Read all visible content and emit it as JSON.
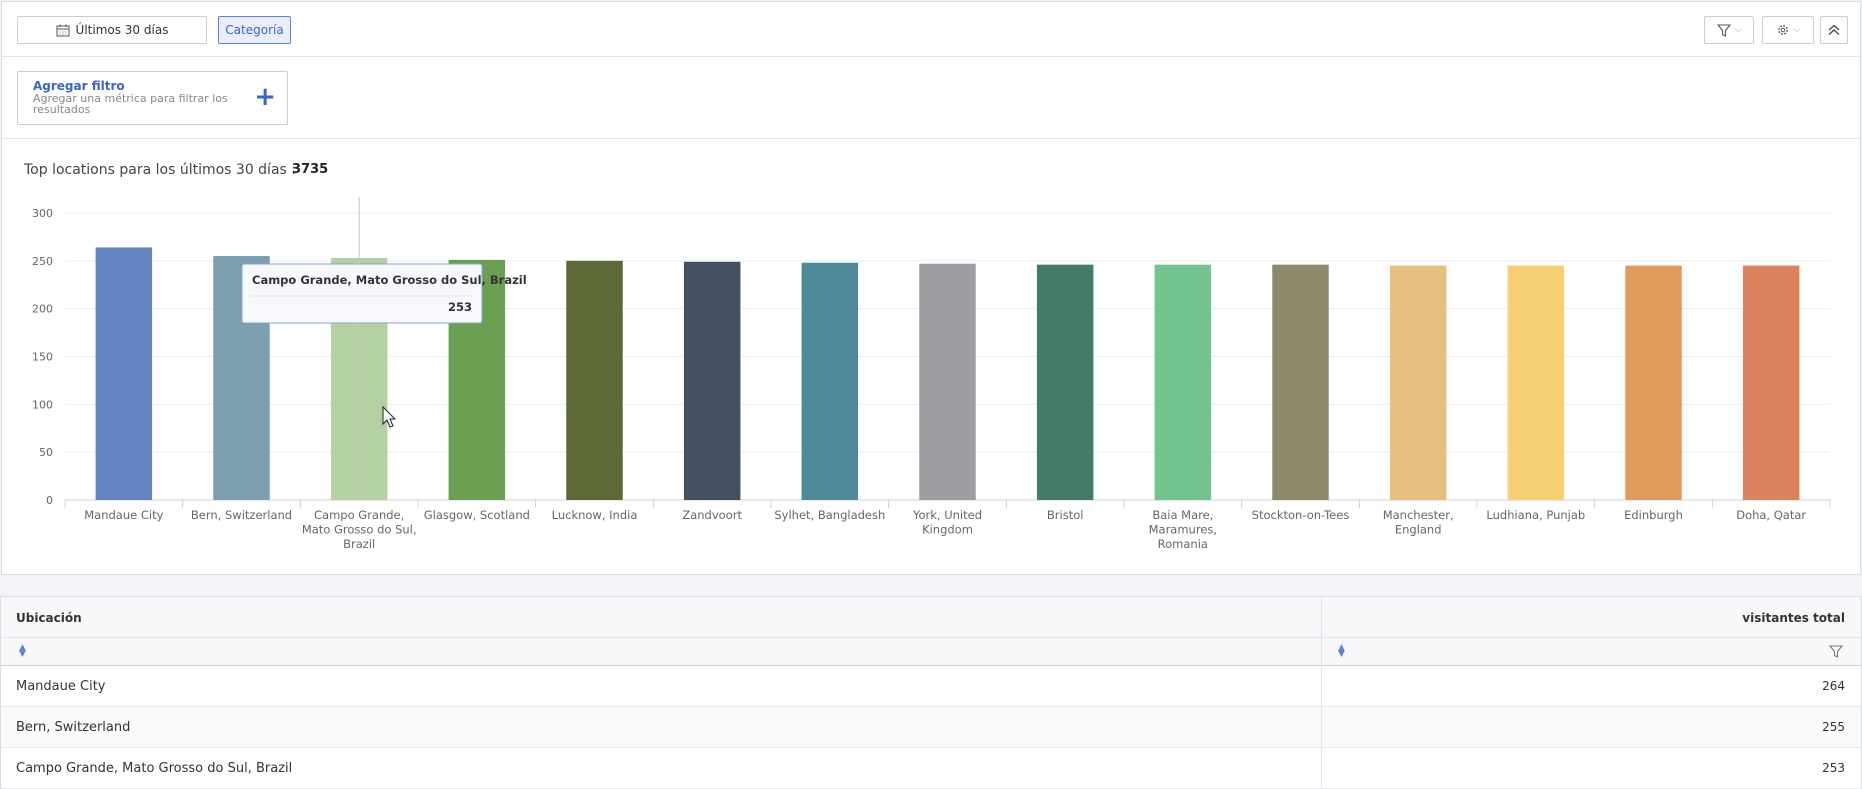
{
  "toolbar": {
    "date_range_label": "Últimos 30 días",
    "category_label": "Categoría"
  },
  "filter": {
    "title": "Agregar filtro",
    "description": "Agregar una métrica para filtrar los resultados"
  },
  "chart": {
    "title": "Top locations para los últimos 30 días :",
    "total": "3735",
    "tooltip": {
      "label": "Campo Grande, Mato Grosso do Sul, Brazil",
      "value": "253"
    }
  },
  "chart_data": {
    "type": "bar",
    "categories": [
      "Mandaue City",
      "Bern, Switzerland",
      "Campo Grande, Mato Grosso do Sul, Brazil",
      "Glasgow, Scotland",
      "Lucknow, India",
      "Zandvoort",
      "Sylhet, Bangladesh",
      "York, United Kingdom",
      "Bristol",
      "Baia Mare, Maramures, Romania",
      "Stockton-on-Tees",
      "Manchester, England",
      "Ludhiana, Punjab",
      "Edinburgh",
      "Doha, Qatar"
    ],
    "category_lines": [
      [
        "Mandaue City"
      ],
      [
        "Bern, Switzerland"
      ],
      [
        "Campo Grande,",
        "Mato Grosso do Sul,",
        "Brazil"
      ],
      [
        "Glasgow, Scotland"
      ],
      [
        "Lucknow, India"
      ],
      [
        "Zandvoort"
      ],
      [
        "Sylhet, Bangladesh"
      ],
      [
        "York, United",
        "Kingdom"
      ],
      [
        "Bristol"
      ],
      [
        "Baia Mare,",
        "Maramures,",
        "Romania"
      ],
      [
        "Stockton-on-Tees"
      ],
      [
        "Manchester,",
        "England"
      ],
      [
        "Ludhiana, Punjab"
      ],
      [
        "Edinburgh"
      ],
      [
        "Doha, Qatar"
      ]
    ],
    "values": [
      264,
      255,
      253,
      251,
      250,
      249,
      248,
      247,
      246,
      246,
      246,
      245,
      245,
      245,
      245
    ],
    "colors": [
      "#6585c0",
      "#7b9eb0",
      "#b3d1a3",
      "#6ba053",
      "#5e6a35",
      "#42505f",
      "#4e8a98",
      "#9e9ea2",
      "#437b68",
      "#74c490",
      "#8e8a69",
      "#e5c07f",
      "#f5cf71",
      "#e29a5c",
      "#dc825c"
    ],
    "ylim": [
      0,
      300
    ],
    "yticks": [
      0,
      50,
      100,
      150,
      200,
      250,
      300
    ],
    "grid": true,
    "highlighted_index": 2
  },
  "table": {
    "columns": [
      "Ubicación",
      "visitantes total"
    ],
    "rows": [
      {
        "location": "Mandaue City",
        "visitors": "264"
      },
      {
        "location": "Bern, Switzerland",
        "visitors": "255"
      },
      {
        "location": "Campo Grande, Mato Grosso do Sul, Brazil",
        "visitors": "253"
      }
    ]
  },
  "icons": {
    "calendar": "calendar-icon",
    "filter": "filter-icon",
    "gear": "gear-icon",
    "collapse": "chevron-double-up-icon",
    "plus": "plus-icon",
    "sort": "sort-icon"
  },
  "colors": {
    "accent": "#3a66c8"
  }
}
